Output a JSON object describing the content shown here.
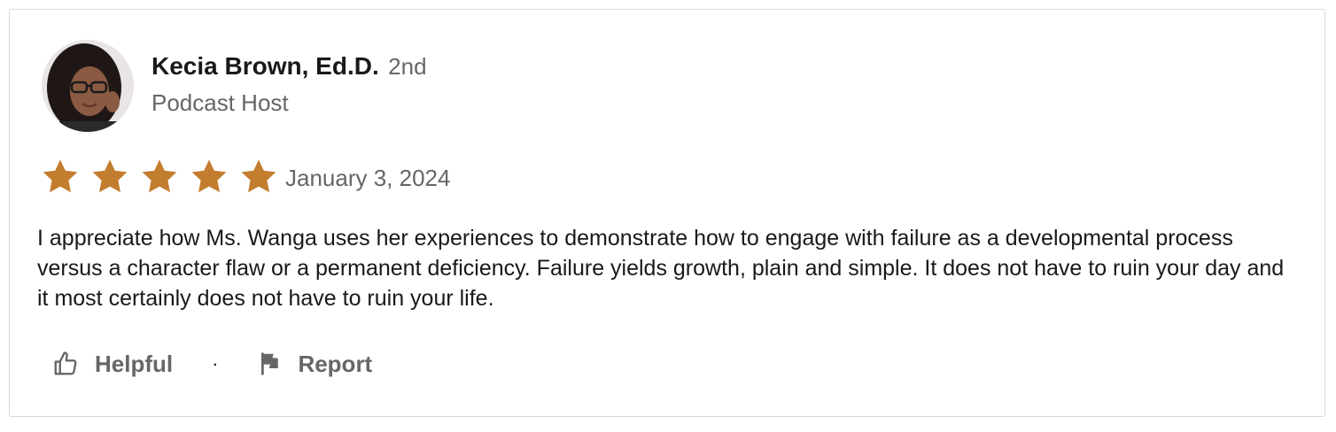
{
  "reviewer": {
    "name": "Kecia Brown, Ed.D.",
    "connection_degree": "2nd",
    "headline": "Podcast Host",
    "avatar_icon": "profile-photo"
  },
  "rating": {
    "stars": 5,
    "max": 5,
    "star_color": "#c37d2e",
    "date": "January 3, 2024"
  },
  "review": {
    "text": "I appreciate how Ms. Wanga uses her experiences to demonstrate how to engage with failure as a developmental process versus a character flaw or a permanent deficiency. Failure yields growth, plain and simple. It does not have to ruin your day and it most certainly does not have to ruin your life."
  },
  "actions": {
    "helpful_label": "Helpful",
    "helpful_icon": "thumbs-up-icon",
    "separator": "·",
    "report_label": "Report",
    "report_icon": "flag-icon"
  }
}
